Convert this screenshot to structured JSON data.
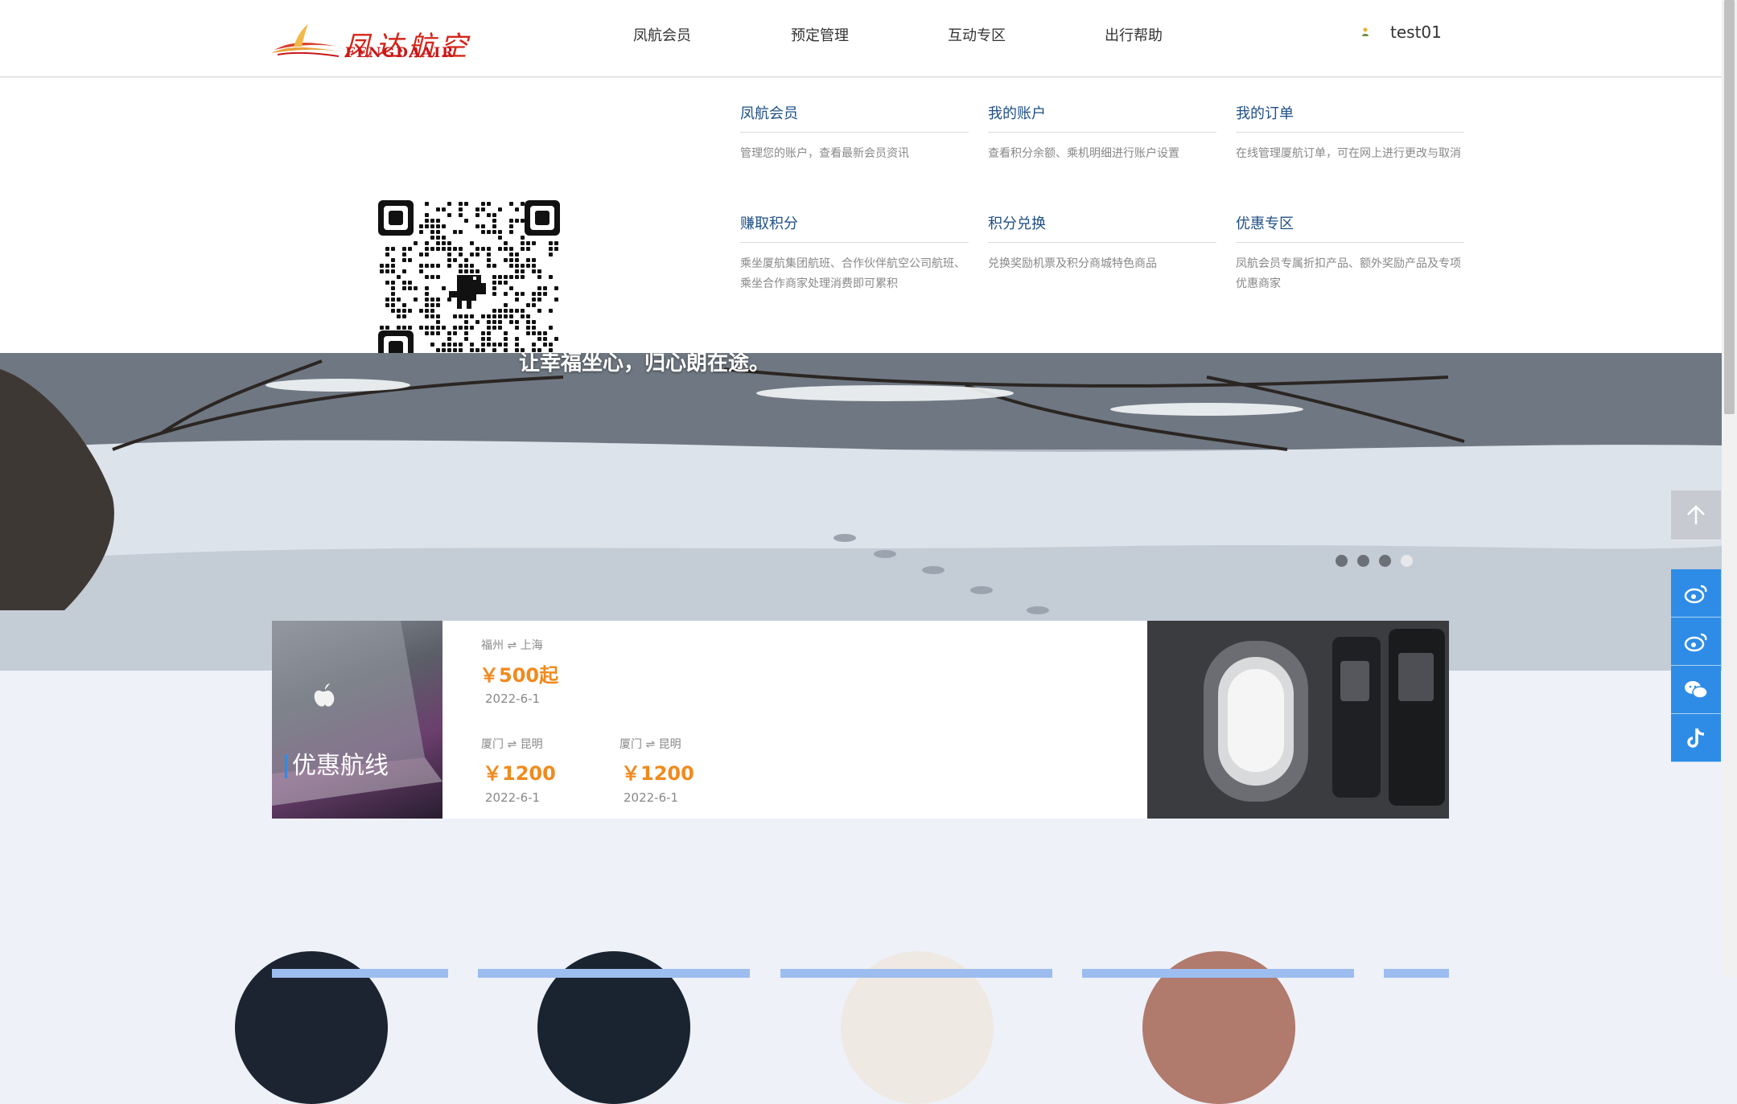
{
  "header": {
    "logo_text": "凤达航空",
    "logo_sub": "FENGDAAIR",
    "nav": [
      "凤航会员",
      "预定管理",
      "互动专区",
      "出行帮助"
    ],
    "username": "test01"
  },
  "dropdown": {
    "columns": [
      {
        "title": "凤航会员",
        "desc": "管理您的账户，查看最新会员资讯"
      },
      {
        "title": "我的账户",
        "desc": "查看积分余额、乘机明细进行账户设置"
      },
      {
        "title": "我的订单",
        "desc": "在线管理厦航订单，可在网上进行更改与取消"
      },
      {
        "title": "赚取积分",
        "desc": "乘坐厦航集团航班、合作伙伴航空公司航班、乘坐合作商家处理消费即可累积"
      },
      {
        "title": "积分兑换",
        "desc": "兑换奖励机票及积分商城特色商品"
      },
      {
        "title": "优惠专区",
        "desc": "凤航会员专属折扣产品、额外奖励产品及专项优惠商家"
      }
    ]
  },
  "banner": {
    "caption": "让幸福坐心，归心朗在途。",
    "slide_count": 4,
    "active_slide": 4
  },
  "deals": {
    "title": "优惠航线",
    "items": [
      {
        "route": "福州 ⇌ 上海",
        "price": "￥500起",
        "date": "2022-6-1"
      },
      {
        "route": "厦门 ⇌ 昆明",
        "price": "￥1200",
        "date": "2022-6-1"
      },
      {
        "route": "厦门 ⇌ 昆明",
        "price": "￥1200",
        "date": "2022-6-1"
      }
    ]
  },
  "float_bar": {
    "icons": [
      "arrow-up-icon",
      "weibo-icon",
      "weibo-icon",
      "wechat-icon",
      "tiktok-icon"
    ],
    "color": "#2e8ce6"
  }
}
